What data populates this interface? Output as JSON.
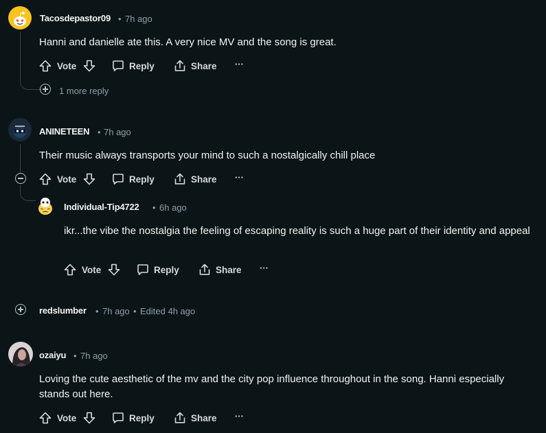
{
  "comments": [
    {
      "author": "Tacosdepastor09",
      "time": "7h ago",
      "text": "Hanni and danielle ate this. A very nice MV and the song is great.",
      "vote_label": "Vote",
      "reply_label": "Reply",
      "share_label": "Share",
      "more_replies": "1 more reply"
    },
    {
      "author": "ANINETEEN",
      "time": "7h ago",
      "text": "Their music always transports your mind to such a nostalgically chill place",
      "vote_label": "Vote",
      "reply_label": "Reply",
      "share_label": "Share",
      "replies": [
        {
          "author": "Individual-Tip4722",
          "time": "6h ago",
          "text": "ikr...the vibe the nostalgia the feeling of escaping reality is such a huge part of their identity and appeal",
          "vote_label": "Vote",
          "reply_label": "Reply",
          "share_label": "Share"
        }
      ]
    },
    {
      "author": "redslumber",
      "time": "7h ago",
      "edited": "Edited 4h ago",
      "collapsed": true
    },
    {
      "author": "ozaiyu",
      "time": "7h ago",
      "text": "Loving the cute aesthetic of the mv and the city pop influence throughout in the song. Hanni especially stands out here.",
      "vote_label": "Vote",
      "reply_label": "Reply",
      "share_label": "Share"
    }
  ],
  "separator": "•",
  "overflow_label": "···",
  "colors": {
    "background": "#0b1416",
    "text": "#f2f4f5",
    "meta": "#8ba2ad",
    "thread_line": "#33464c",
    "action_text": "#d7dadc"
  }
}
